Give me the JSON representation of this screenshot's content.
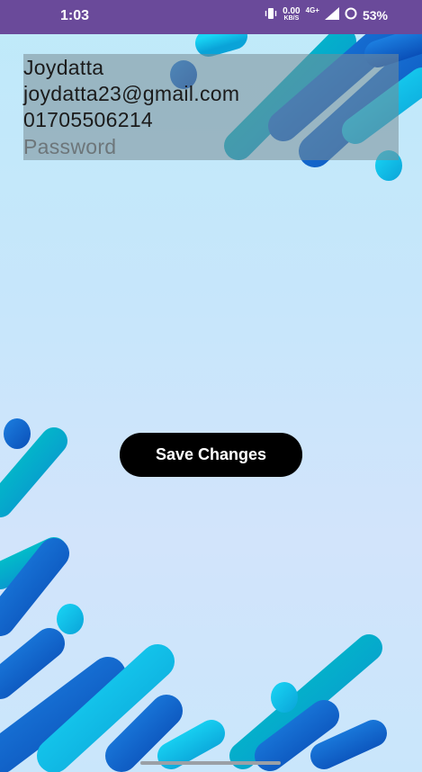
{
  "status_bar": {
    "time": "1:03",
    "net_speed_value": "0.00",
    "net_speed_unit": "KB/S",
    "network_type": "4G+",
    "battery": "53%"
  },
  "form": {
    "name": "Joydatta",
    "email": "joydatta23@gmail.com",
    "phone": "01705506214",
    "password_placeholder": "Password"
  },
  "actions": {
    "save_label": "Save Changes"
  },
  "colors": {
    "status_bar": "#6a4a9a",
    "accent_blue": "#0a78d0",
    "accent_cyan": "#00c2e0",
    "button": "#000000"
  }
}
